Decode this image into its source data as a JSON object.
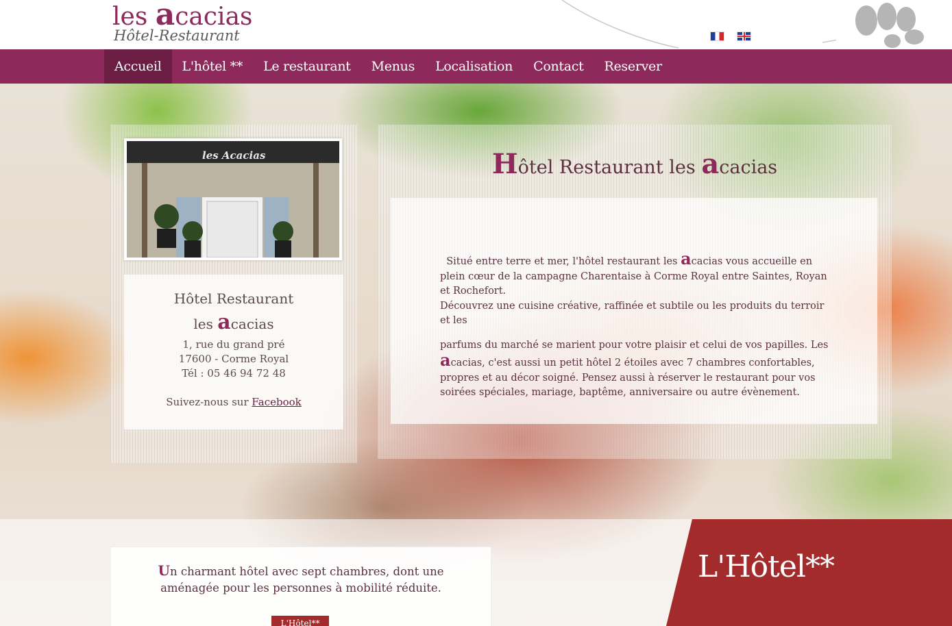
{
  "header": {
    "logo_line1_prefix": "les ",
    "logo_line1_big": "a",
    "logo_line1_suffix": "cacias",
    "logo_line2": "Hôtel-Restaurant",
    "languages": [
      {
        "code": "fr",
        "icon": "france-flag-icon"
      },
      {
        "code": "en",
        "icon": "uk-flag-icon"
      }
    ]
  },
  "nav": {
    "items": [
      {
        "label": "Accueil",
        "active": true
      },
      {
        "label": "L'hôtel **",
        "active": false
      },
      {
        "label": "Le restaurant",
        "active": false
      },
      {
        "label": "Menus",
        "active": false
      },
      {
        "label": "Localisation",
        "active": false
      },
      {
        "label": "Contact",
        "active": false
      },
      {
        "label": "Reserver",
        "active": false
      }
    ]
  },
  "left": {
    "photo_sign": "les Acacias",
    "title_line1": "Hôtel Restaurant",
    "title_line2_prefix": "les ",
    "title_line2_big": "a",
    "title_line2_suffix": "cacias",
    "address_line1": "1, rue du grand pré",
    "address_line2": "17600 - Corme Royal",
    "phone": "Tél : 05 46 94 72 48",
    "follow_prefix": "Suivez-nous sur ",
    "follow_link": "Facebook"
  },
  "main": {
    "title_big_h": "H",
    "title_mid": "ôtel Restaurant les ",
    "title_big_a": "a",
    "title_end": "cacias",
    "p1_a": "Situé entre terre et mer, l'hôtel restaurant les ",
    "p1_big": "a",
    "p1_b": "cacias vous accueille en plein cœur de la campagne Charentaise à Corme Royal entre Saintes, Royan et Rochefort.",
    "p2": "Découvrez une cuisine créative, raffinée et subtile ou les produits du terroir et les",
    "p3_a": "parfums du marché se marient pour votre plaisir et celui de vos papilles. Les ",
    "p3_big": "a",
    "p3_b": "cacias, c'est aussi un petit hôtel 2 étoiles avec 7 chambres confortables, propres et au décor soigné. Pensez aussi à réserver le restaurant pour vos soirées spéciales, mariage, baptême, anniversaire ou autre évènement."
  },
  "hotel_section": {
    "text_cap": "U",
    "text_rest": "n charmant hôtel avec sept chambres, dont une aménagée pour les personnes à mobilité réduite.",
    "button_label": "L'Hôtel**",
    "panel_title": "L'Hôtel**"
  },
  "colors": {
    "brand": "#8e2a5b",
    "nav_active": "#6b1d43",
    "red_panel": "#a32b2b"
  }
}
